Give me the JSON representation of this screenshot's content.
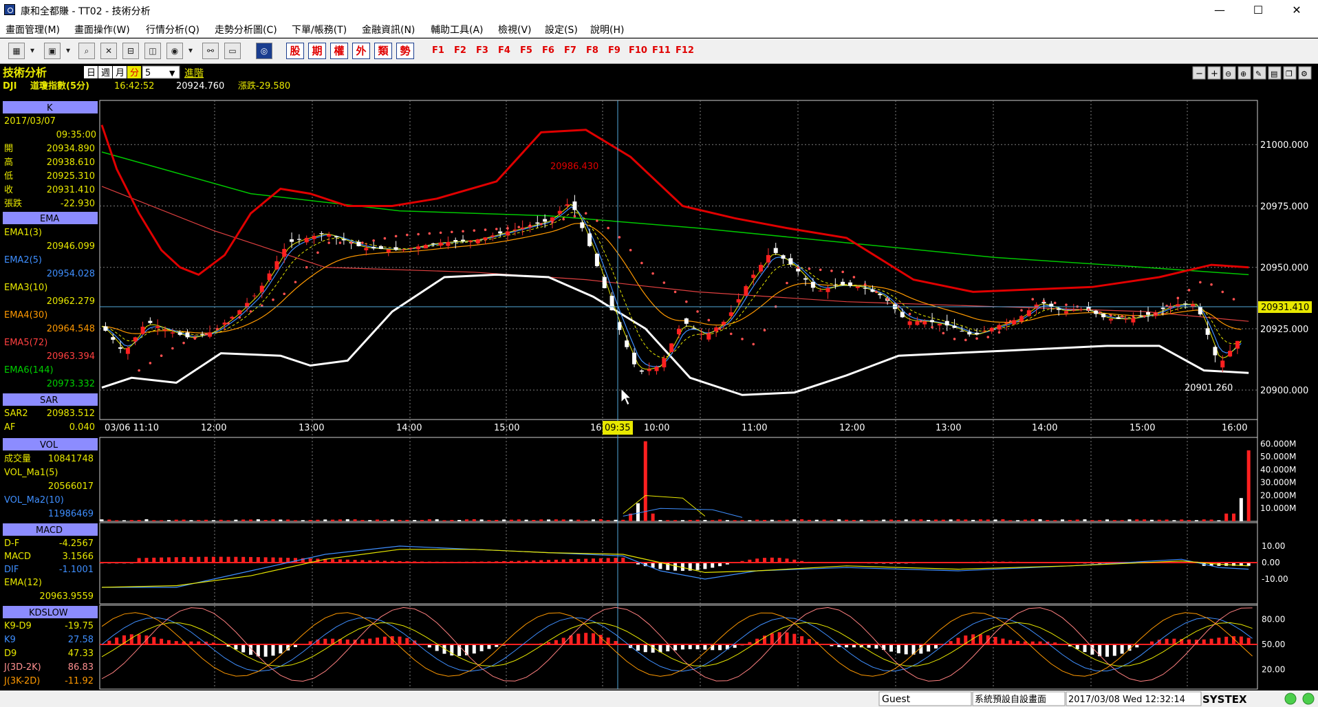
{
  "window": {
    "title": "康和全都賺 - TT02 - 技術分析",
    "minimize": "—",
    "maximize": "☐",
    "close": "✕"
  },
  "menu": [
    "畫面管理(M)",
    "畫面操作(W)",
    "行情分析(Q)",
    "走勢分析圖(C)",
    "下單/帳務(T)",
    "金融資訊(N)",
    "輔助工具(A)",
    "檢視(V)",
    "設定(S)",
    "說明(H)"
  ],
  "toolbar": {
    "red_buttons": [
      "股",
      "期",
      "權",
      "外",
      "類",
      "勢"
    ],
    "fkeys": [
      "F1",
      "F2",
      "F3",
      "F4",
      "F5",
      "F6",
      "F7",
      "F8",
      "F9",
      "F10",
      "F11",
      "F12"
    ]
  },
  "chart_header": {
    "section_title": "技術分析",
    "periods": [
      "日",
      "週",
      "月",
      "分"
    ],
    "active_period": "分",
    "interval": "5",
    "advanced": "進階",
    "symbol": "DJI",
    "name": "道瓊指數(5分)",
    "time": "16:42:52",
    "price": "20924.760",
    "change": "漲跌-29.580"
  },
  "colors": {
    "accent_red": "#e00000",
    "label_bg": "#8c8cff",
    "yellow_text": "#e8e800",
    "white_line": "#ffffff",
    "green_line": "#00c800"
  },
  "k_panel": {
    "header": "K",
    "date": "2017/03/07",
    "time": "09:35:00",
    "open_label": "開",
    "open": "20934.890",
    "high_label": "高",
    "high": "20938.610",
    "low_label": "低",
    "low": "20925.310",
    "close_label": "收",
    "close": "20931.410",
    "chg_label": "張跌",
    "chg": "-22.930"
  },
  "ema_panel": {
    "header": "EMA",
    "items": [
      {
        "label": "EMA1(3)",
        "value": "20946.099",
        "color": "#e8e800"
      },
      {
        "label": "EMA2(5)",
        "value": "20954.028",
        "color": "#3f8fff"
      },
      {
        "label": "EMA3(10)",
        "value": "20962.279",
        "color": "#e8e800"
      },
      {
        "label": "EMA4(30)",
        "value": "20964.548",
        "color": "#ff9900"
      },
      {
        "label": "EMA5(72)",
        "value": "20963.394",
        "color": "#ff4040"
      },
      {
        "label": "EMA6(144)",
        "value": "20973.332",
        "color": "#00d000"
      }
    ]
  },
  "sar_panel": {
    "header": "SAR",
    "sar_label": "SAR2",
    "sar_value": "20983.512",
    "af_label": "AF",
    "af_value": "0.040"
  },
  "vol_panel": {
    "header": "VOL",
    "vol_label": "成交量",
    "vol_value": "10841748",
    "ma1_label": "VOL_Ma1(5)",
    "ma1_value": "20566017",
    "ma2_label": "VOL_Ma2(10)",
    "ma2_value": "11986469"
  },
  "macd_panel": {
    "header": "MACD",
    "df_label": "D-F",
    "df_value": "-4.2567",
    "macd_label": "MACD",
    "macd_value": "3.1566",
    "dif_label": "DIF",
    "dif_value": "-1.1001",
    "ema_label": "EMA(12)",
    "ema_value": "20963.9559"
  },
  "kd_panel": {
    "header": "KDSLOW",
    "k9d9_label": "K9-D9",
    "k9d9_value": "-19.75",
    "k9_label": "K9",
    "k9_value": "27.58",
    "d9_label": "D9",
    "d9_value": "47.33",
    "j1_label": "J(3D-2K)",
    "j1_value": "86.83",
    "j2_label": "J(3K-2D)",
    "j2_value": "-11.92"
  },
  "chart_data": {
    "type": "line",
    "price_axis": [
      "21000.000",
      "20975.000",
      "20950.000",
      "20925.000",
      "20900.000"
    ],
    "price_ylim": [
      20888,
      21018
    ],
    "time_axis": [
      "03/06 11:10",
      "12:00",
      "13:00",
      "14:00",
      "15:00",
      "16:00",
      "10:00",
      "11:00",
      "12:00",
      "13:00",
      "14:00",
      "15:00",
      "16:00"
    ],
    "cursor_time": "09:35",
    "high_annotation": "20986.430",
    "low_annotation": "20901.260",
    "last_price": "20931.410",
    "vol_axis": [
      "60.000M",
      "50.000M",
      "40.000M",
      "30.000M",
      "20.000M",
      "10.000M"
    ],
    "macd_axis": [
      "10.00",
      "0.00",
      "-10.00"
    ],
    "kd_axis": [
      "80.00",
      "50.00",
      "20.00"
    ],
    "bb_upper": [
      [
        0,
        21008
      ],
      [
        4,
        20990
      ],
      [
        10,
        20972
      ],
      [
        16,
        20957
      ],
      [
        21,
        20950
      ],
      [
        26,
        20947
      ],
      [
        33,
        20955
      ],
      [
        40,
        20972
      ],
      [
        48,
        20982
      ],
      [
        56,
        20980
      ],
      [
        66,
        20975
      ],
      [
        78,
        20975
      ],
      [
        90,
        20978
      ],
      [
        106,
        20985
      ],
      [
        118,
        21005
      ],
      [
        130,
        21006
      ],
      [
        142,
        20995
      ],
      [
        156,
        20975
      ],
      [
        170,
        20970
      ],
      [
        184,
        20966
      ],
      [
        200,
        20962
      ],
      [
        218,
        20945
      ],
      [
        234,
        20940
      ],
      [
        250,
        20941
      ],
      [
        266,
        20942
      ],
      [
        284,
        20946
      ],
      [
        298,
        20951
      ],
      [
        308,
        20950
      ]
    ],
    "bb_lower": [
      [
        0,
        20901
      ],
      [
        8,
        20905
      ],
      [
        20,
        20903
      ],
      [
        32,
        20915
      ],
      [
        48,
        20914
      ],
      [
        56,
        20910
      ],
      [
        66,
        20912
      ],
      [
        78,
        20932
      ],
      [
        92,
        20946
      ],
      [
        106,
        20947
      ],
      [
        120,
        20946
      ],
      [
        132,
        20938
      ],
      [
        146,
        20925
      ],
      [
        158,
        20905
      ],
      [
        172,
        20898
      ],
      [
        186,
        20899
      ],
      [
        200,
        20906
      ],
      [
        214,
        20914
      ],
      [
        228,
        20915
      ],
      [
        242,
        20916
      ],
      [
        256,
        20917
      ],
      [
        270,
        20918
      ],
      [
        284,
        20918
      ],
      [
        296,
        20908
      ],
      [
        308,
        20907
      ]
    ],
    "ema_slow": [
      [
        0,
        20997
      ],
      [
        40,
        20980
      ],
      [
        80,
        20973
      ],
      [
        120,
        20971
      ],
      [
        160,
        20966
      ],
      [
        200,
        20960
      ],
      [
        240,
        20954
      ],
      [
        280,
        20950
      ],
      [
        308,
        20947
      ]
    ],
    "ema_mid": [
      [
        0,
        20983
      ],
      [
        30,
        20965
      ],
      [
        60,
        20950
      ],
      [
        100,
        20948
      ],
      [
        130,
        20945
      ],
      [
        160,
        20940
      ],
      [
        200,
        20936
      ],
      [
        240,
        20934
      ],
      [
        280,
        20932
      ],
      [
        308,
        20928
      ]
    ],
    "close": [
      [
        0,
        20926
      ],
      [
        6,
        20915
      ],
      [
        12,
        20928
      ],
      [
        18,
        20924
      ],
      [
        24,
        20921
      ],
      [
        30,
        20924
      ],
      [
        36,
        20931
      ],
      [
        42,
        20940
      ],
      [
        50,
        20960
      ],
      [
        60,
        20964
      ],
      [
        70,
        20958
      ],
      [
        80,
        20957
      ],
      [
        90,
        20960
      ],
      [
        100,
        20961
      ],
      [
        110,
        20965
      ],
      [
        120,
        20969
      ],
      [
        126,
        20977
      ],
      [
        132,
        20955
      ],
      [
        138,
        20928
      ],
      [
        144,
        20907
      ],
      [
        150,
        20910
      ],
      [
        156,
        20928
      ],
      [
        162,
        20922
      ],
      [
        168,
        20929
      ],
      [
        174,
        20945
      ],
      [
        180,
        20957
      ],
      [
        186,
        20950
      ],
      [
        192,
        20940
      ],
      [
        198,
        20943
      ],
      [
        204,
        20942
      ],
      [
        210,
        20938
      ],
      [
        216,
        20928
      ],
      [
        222,
        20928
      ],
      [
        228,
        20926
      ],
      [
        234,
        20922
      ],
      [
        240,
        20926
      ],
      [
        246,
        20929
      ],
      [
        252,
        20936
      ],
      [
        258,
        20932
      ],
      [
        264,
        20933
      ],
      [
        270,
        20929
      ],
      [
        276,
        20929
      ],
      [
        282,
        20931
      ],
      [
        288,
        20935
      ],
      [
        294,
        20935
      ],
      [
        300,
        20910
      ],
      [
        306,
        20922
      ]
    ],
    "sar": [
      [
        10,
        20908
      ],
      [
        20,
        20918
      ],
      [
        30,
        20924
      ],
      [
        40,
        20932
      ],
      [
        50,
        20940
      ],
      [
        60,
        20960
      ],
      [
        70,
        20960
      ],
      [
        80,
        20963
      ],
      [
        90,
        20964
      ],
      [
        100,
        20965
      ],
      [
        110,
        20966
      ],
      [
        120,
        20968
      ],
      [
        130,
        20972
      ],
      [
        138,
        20964
      ],
      [
        146,
        20950
      ],
      [
        154,
        20940
      ],
      [
        160,
        20932
      ],
      [
        166,
        20925
      ],
      [
        176,
        20918
      ],
      [
        186,
        20950
      ],
      [
        200,
        20948
      ],
      [
        212,
        20936
      ],
      [
        220,
        20928
      ],
      [
        230,
        20920
      ],
      [
        240,
        20922
      ],
      [
        250,
        20937
      ],
      [
        262,
        20934
      ],
      [
        272,
        20930
      ],
      [
        282,
        20930
      ],
      [
        296,
        20945
      ],
      [
        306,
        20935
      ]
    ]
  }
}
